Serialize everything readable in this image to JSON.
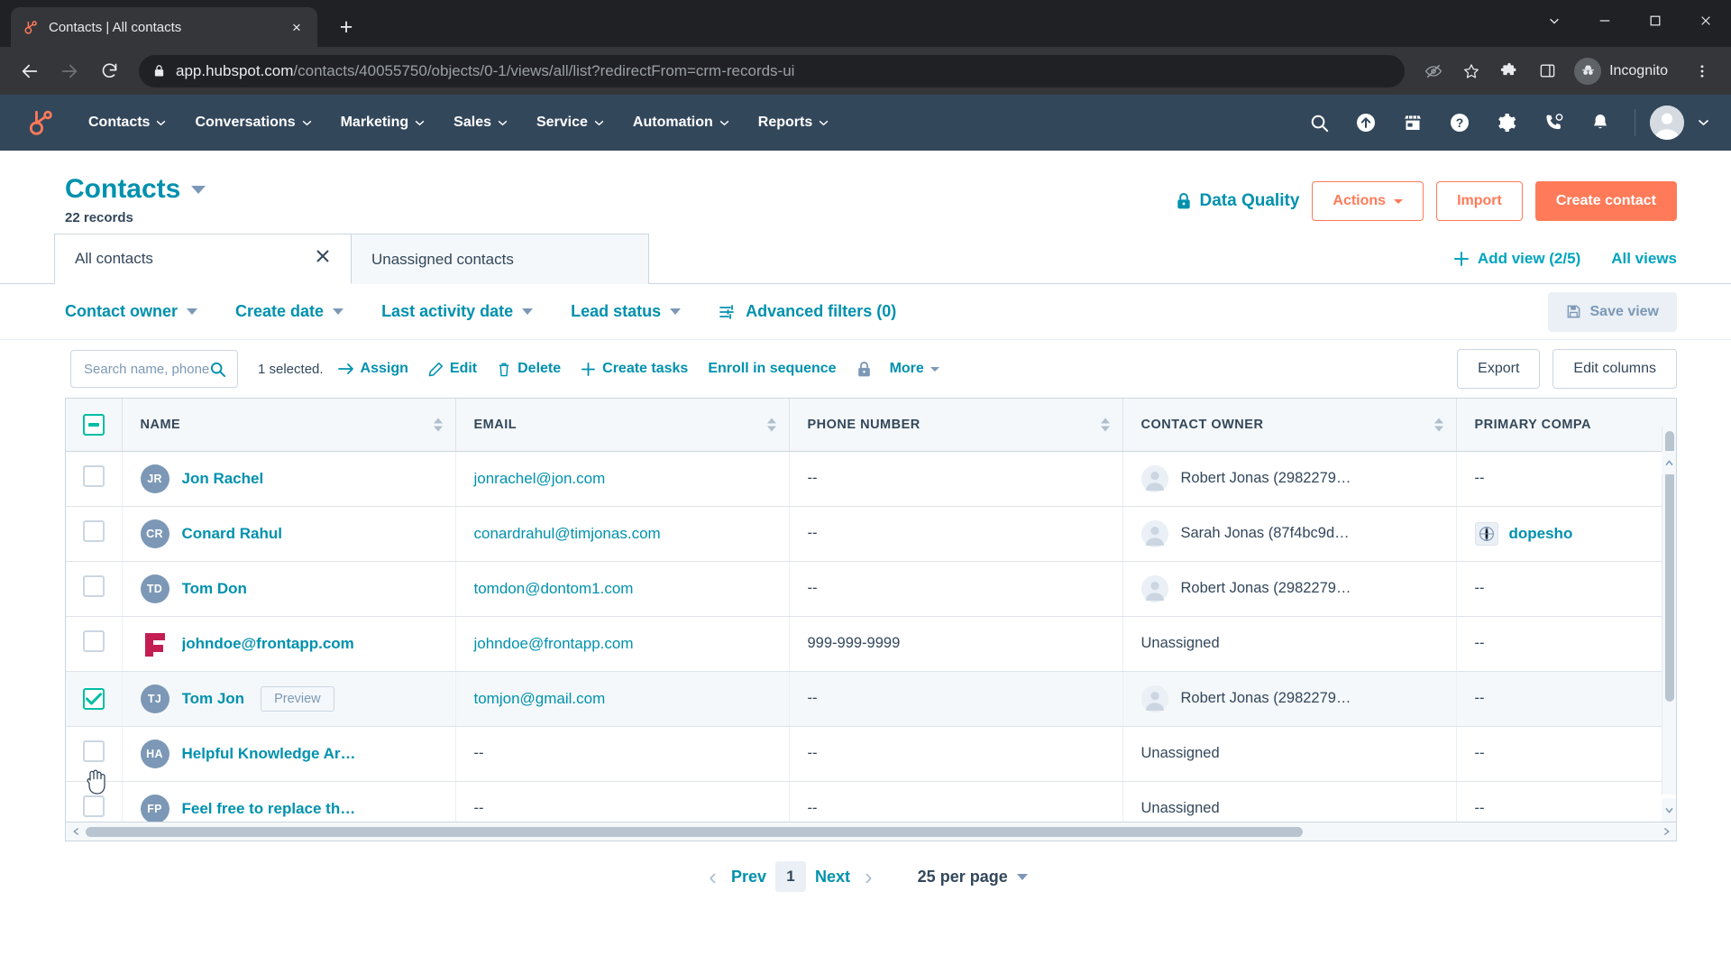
{
  "browser": {
    "tab": {
      "title": "Contacts | All contacts",
      "favicon": "hubspot-sprocket-icon",
      "close": "×"
    },
    "new_tab": "+",
    "window_controls": [
      "chevron-down-icon",
      "minimize-icon",
      "maximize-icon",
      "close-icon"
    ],
    "nav": {
      "back": "back-icon",
      "forward": "forward-icon",
      "reload": "reload-icon"
    },
    "omnibox": {
      "lock": "lock-icon",
      "url_host": "app.hubspot.com",
      "url_path": "/contacts/40055750/objects/0-1/views/all/list?redirectFrom=crm-records-ui"
    },
    "toolbar_icons": [
      "eye-slash-icon",
      "star-icon",
      "extensions-icon",
      "side-panel-icon"
    ],
    "profile": {
      "label": "Incognito",
      "icon": "incognito-icon"
    },
    "menu": "kebab-menu-icon"
  },
  "hubspot_nav": {
    "logo": "hubspot-sprocket-icon",
    "items": [
      {
        "label": "Contacts",
        "caret": true
      },
      {
        "label": "Conversations",
        "caret": true
      },
      {
        "label": "Marketing",
        "caret": true
      },
      {
        "label": "Sales",
        "caret": true
      },
      {
        "label": "Service",
        "caret": true
      },
      {
        "label": "Automation",
        "caret": true
      },
      {
        "label": "Reports",
        "caret": true
      }
    ],
    "right_icons": [
      "search-icon",
      "upgrade-arrow-icon",
      "marketplace-icon",
      "help-circle-icon",
      "settings-gear-icon",
      "phone-icon",
      "notifications-bell-icon"
    ],
    "avatar": "user-avatar-icon",
    "avatar_caret": "chevron-down-icon"
  },
  "page_header": {
    "title": "Contacts",
    "title_caret": "caret-down-icon",
    "records": "22 records",
    "data_quality": {
      "label": "Data Quality",
      "icon": "lock-icon"
    },
    "actions_button": "Actions",
    "import_button": "Import",
    "create_button": "Create contact"
  },
  "view_tabs": {
    "tabs": [
      {
        "label": "All contacts",
        "active": true,
        "closable": true,
        "close": "×"
      },
      {
        "label": "Unassigned contacts",
        "active": false,
        "closable": false
      }
    ],
    "add_view": "Add view (2/5)",
    "add_view_icon": "plus-icon",
    "all_views": "All views"
  },
  "filters": {
    "items": [
      {
        "label": "Contact owner",
        "caret": true
      },
      {
        "label": "Create date",
        "caret": true
      },
      {
        "label": "Last activity date",
        "caret": true
      },
      {
        "label": "Lead status",
        "caret": true
      },
      {
        "label": "Advanced filters (0)",
        "caret": false,
        "icon": "sliders-icon"
      }
    ],
    "save_view": {
      "label": "Save view",
      "icon": "save-disk-icon"
    }
  },
  "action_bar": {
    "search_placeholder": "Search name, phone, em",
    "search_value": "",
    "search_icon": "search-icon",
    "selected_text": "1 selected.",
    "actions": [
      {
        "label": "Assign",
        "icon": "arrow-right-icon"
      },
      {
        "label": "Edit",
        "icon": "pencil-icon"
      },
      {
        "label": "Delete",
        "icon": "trash-icon"
      },
      {
        "label": "Create tasks",
        "icon": "plus-icon"
      },
      {
        "label": "Enroll in sequence",
        "icon": ""
      }
    ],
    "lock_icon": "lock-icon",
    "more": {
      "label": "More",
      "caret": true
    },
    "export_button": "Export",
    "edit_columns_button": "Edit columns"
  },
  "table": {
    "select_all_state": "indeterminate",
    "columns": [
      {
        "key": "name",
        "label": "NAME",
        "sortable": true
      },
      {
        "key": "email",
        "label": "EMAIL",
        "sortable": true
      },
      {
        "key": "phone",
        "label": "PHONE NUMBER",
        "sortable": true
      },
      {
        "key": "owner",
        "label": "CONTACT OWNER",
        "sortable": true
      },
      {
        "key": "company",
        "label": "PRIMARY COMPA",
        "sortable": false
      }
    ],
    "rows": [
      {
        "checked": false,
        "initials": "JR",
        "avatar_type": "initials",
        "name": "Jon Rachel",
        "preview": false,
        "email": "jonrachel@jon.com",
        "phone": "--",
        "owner": "Robert Jonas (2982279…",
        "owner_avatar": true,
        "company": "--",
        "company_logo": false
      },
      {
        "checked": false,
        "initials": "CR",
        "avatar_type": "initials",
        "name": "Conard Rahul",
        "preview": false,
        "email": "conardrahul@timjonas.com",
        "phone": "--",
        "owner": "Sarah Jonas (87f4bc9d…",
        "owner_avatar": true,
        "company": "dopesho",
        "company_logo": true
      },
      {
        "checked": false,
        "initials": "TD",
        "avatar_type": "initials",
        "name": "Tom Don",
        "preview": false,
        "email": "tomdon@dontom1.com",
        "phone": "--",
        "owner": "Robert Jonas (2982279…",
        "owner_avatar": true,
        "company": "--",
        "company_logo": false
      },
      {
        "checked": false,
        "initials": "",
        "avatar_type": "frontapp-logo",
        "name": "johndoe@frontapp.com",
        "preview": false,
        "email": "johndoe@frontapp.com",
        "phone": "999-999-9999",
        "owner": "Unassigned",
        "owner_avatar": false,
        "company": "--",
        "company_logo": false
      },
      {
        "checked": true,
        "initials": "TJ",
        "avatar_type": "initials",
        "name": "Tom Jon",
        "preview": true,
        "preview_label": "Preview",
        "email": "tomjon@gmail.com",
        "phone": "--",
        "owner": "Robert Jonas (2982279…",
        "owner_avatar": true,
        "company": "--",
        "company_logo": false
      },
      {
        "checked": false,
        "initials": "HA",
        "avatar_type": "initials",
        "name": "Helpful Knowledge Ar…",
        "preview": false,
        "email": "--",
        "phone": "--",
        "owner": "Unassigned",
        "owner_avatar": false,
        "company": "--",
        "company_logo": false
      },
      {
        "checked": false,
        "initials": "FP",
        "avatar_type": "initials",
        "name": "Feel free to replace th…",
        "preview": false,
        "email": "--",
        "phone": "--",
        "owner": "Unassigned",
        "owner_avatar": false,
        "company": "--",
        "company_logo": false
      }
    ]
  },
  "pagination": {
    "prev": "Prev",
    "current_page": "1",
    "next": "Next",
    "per_page": "25 per page",
    "prev_chevron": "‹",
    "next_chevron": "›"
  },
  "colors": {
    "hubspot_navy": "#33475b",
    "teal": "#0091ae",
    "teal_bright": "#00a4bd",
    "green": "#00bda5",
    "orange": "#ff7a59",
    "border": "#cbd6e2",
    "light_bg": "#f5f8fa"
  }
}
